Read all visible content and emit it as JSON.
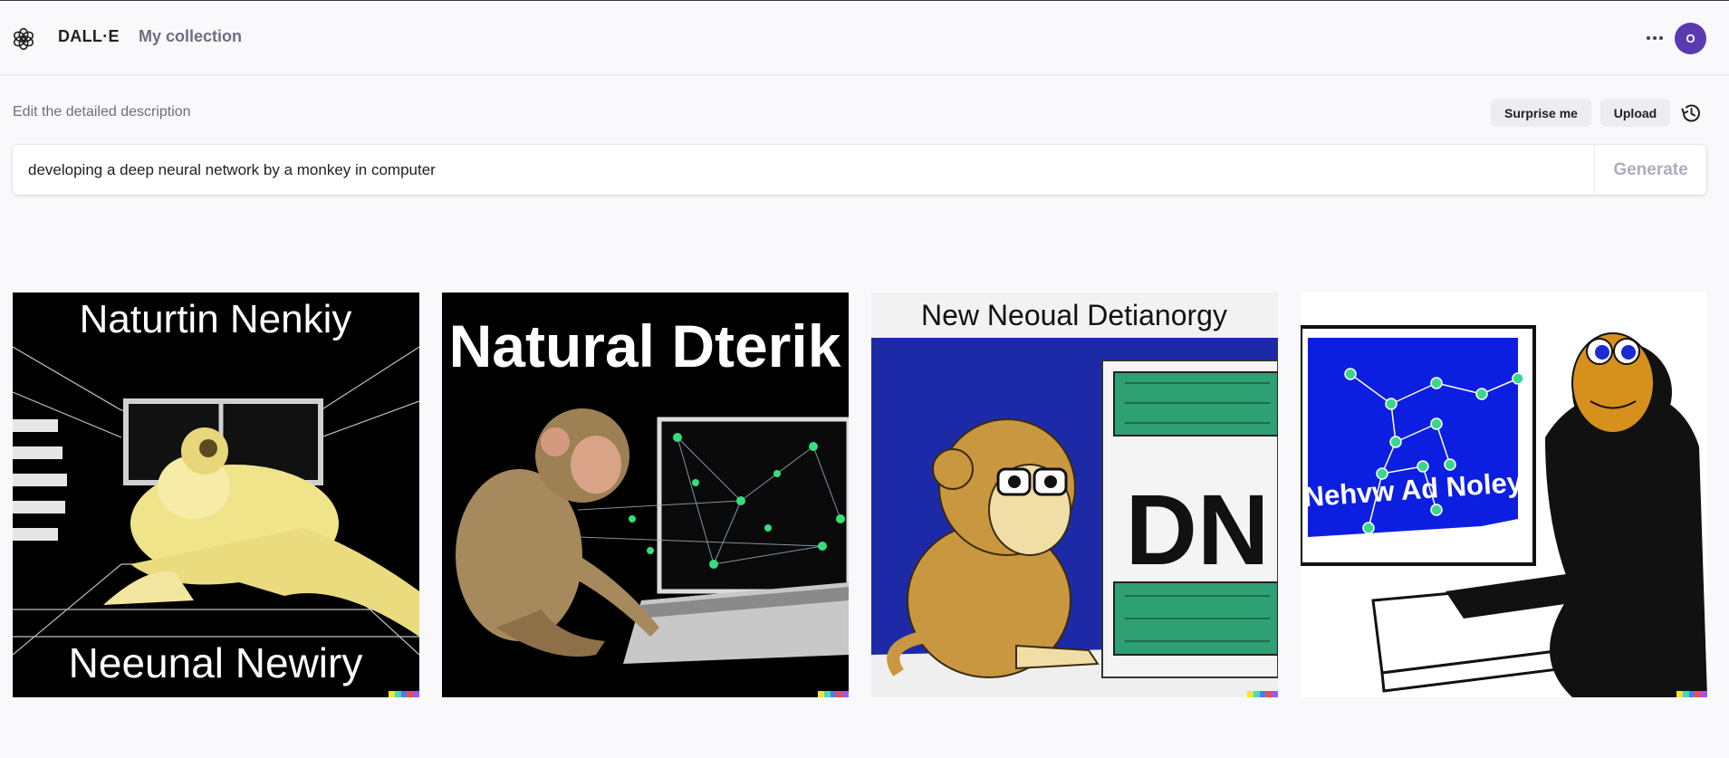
{
  "app": {
    "brand": "DALL·E",
    "nav_collection": "My collection",
    "avatar_initial": "O"
  },
  "prompt": {
    "label": "Edit the detailed description",
    "value": "developing a deep neural network by a monkey in computer",
    "surprise_label": "Surprise me",
    "upload_label": "Upload",
    "generate_label": "Generate"
  },
  "images": [
    {
      "top_text": "Naturtin Nenkiy",
      "bottom_text": "Neeunal Newiry"
    },
    {
      "top_text": "Natural  Dterik"
    },
    {
      "top_text": "New Neoual Detianorgy",
      "center_text": "DN"
    },
    {
      "screen_text": "Nehvw Ad Noley"
    }
  ],
  "colors": {
    "accent_avatar": "#5b3ab0",
    "background": "#f9f9fb",
    "chip_bg": "#ececf1",
    "generate_disabled": "#acacbe",
    "signature": [
      "#f5e52b",
      "#4bd6c4",
      "#4a7cf0",
      "#f04d4d",
      "#9b59f0"
    ]
  },
  "icons": {
    "logo": "openai-logo-icon",
    "more": "more-horizontal-icon",
    "history": "history-icon"
  }
}
